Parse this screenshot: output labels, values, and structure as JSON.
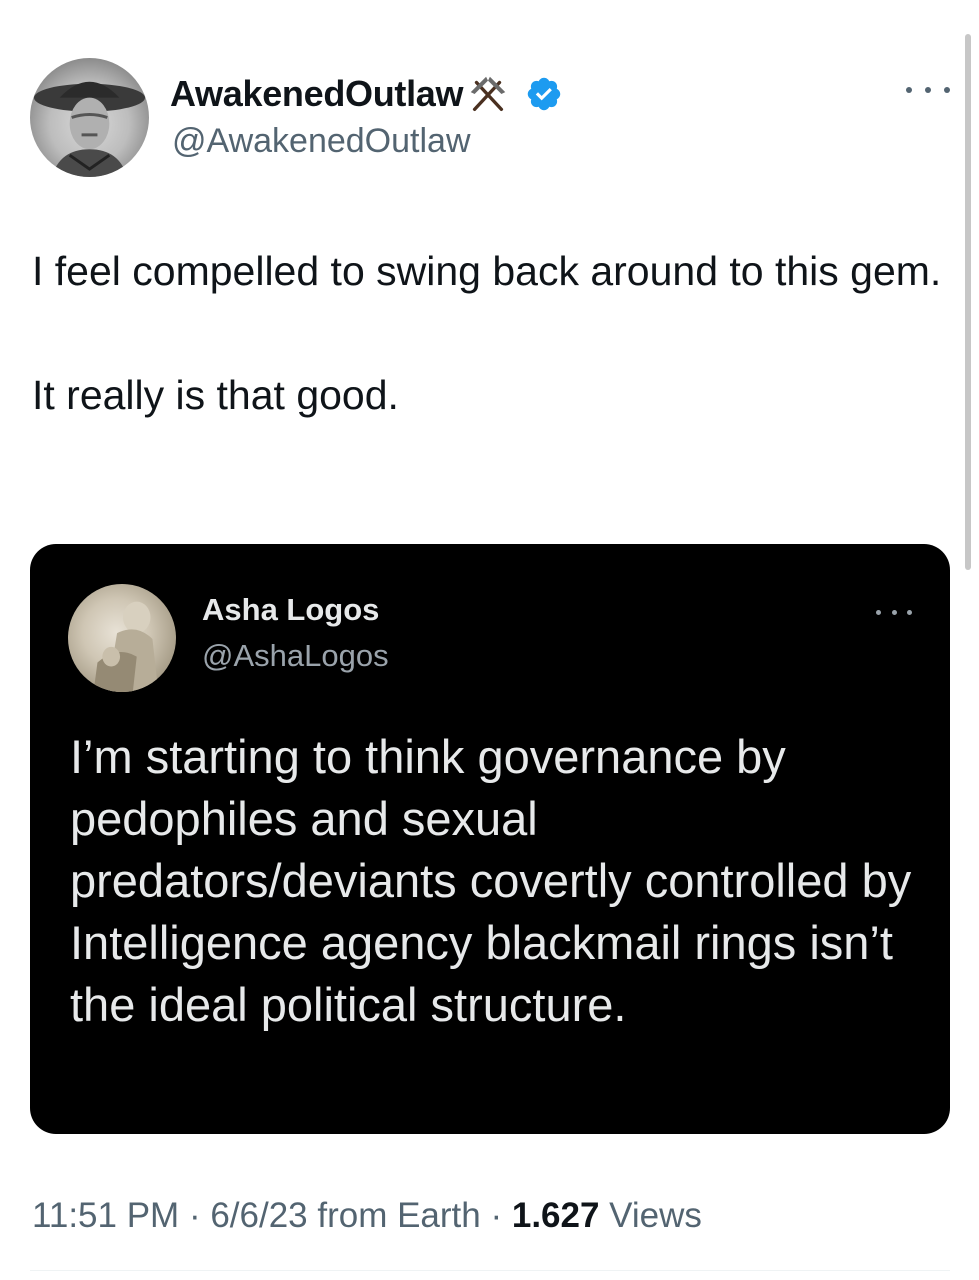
{
  "author": {
    "display_name": "AwakenedOutlaw",
    "name_emoji": "pick-icon",
    "handle": "@AwakenedOutlaw",
    "verified_icon": "verified-badge-icon",
    "avatar": "cowboy-hat-portrait"
  },
  "tweet": {
    "text": "I feel compelled to swing back around to this gem.\n\nIt really is that good."
  },
  "quoted": {
    "display_name": "Asha Logos",
    "handle": "@AshaLogos",
    "avatar": "statue-portrait",
    "text": "I’m starting to think governance by pedophiles and sexual predators/deviants covertly controlled by Intelligence agency blackmail rings isn’t the ideal political structure."
  },
  "meta": {
    "time": "11:51 PM",
    "sep1": " · ",
    "date": "6/6/23",
    "source": " from Earth",
    "sep2": " · ",
    "view_count": "1.627",
    "views_label": " Views"
  },
  "colors": {
    "text_primary": "#0f1419",
    "text_secondary": "#536471",
    "verified_blue": "#1d9bf0",
    "quote_bg": "#000000",
    "quote_text": "#e7e9ea"
  }
}
